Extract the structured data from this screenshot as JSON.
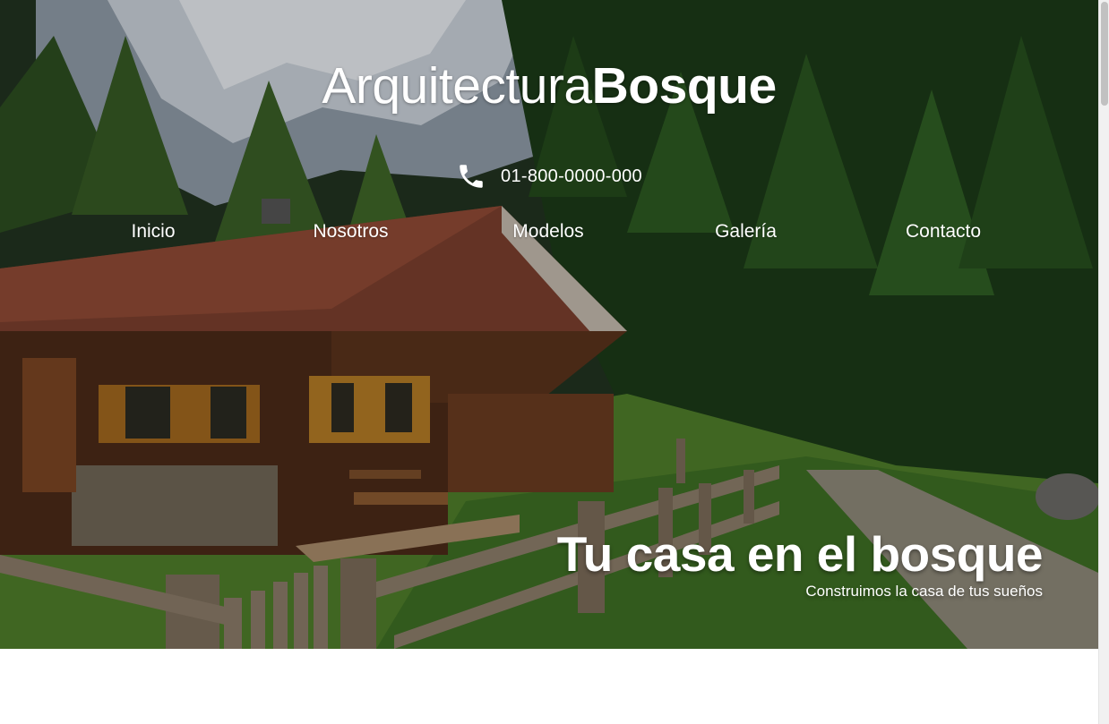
{
  "logo": {
    "light": "Arquitectura",
    "bold": "Bosque"
  },
  "phone": {
    "icon": "phone-icon",
    "number": "01-800-0000-000"
  },
  "nav": [
    {
      "label": "Inicio"
    },
    {
      "label": "Nosotros"
    },
    {
      "label": "Modelos"
    },
    {
      "label": "Galería"
    },
    {
      "label": "Contacto"
    }
  ],
  "hero": {
    "title": "Tu casa en el bosque",
    "subtitle": "Construimos la casa de tus sueños"
  },
  "colors": {
    "text": "#ffffff",
    "background": "#ffffff"
  }
}
